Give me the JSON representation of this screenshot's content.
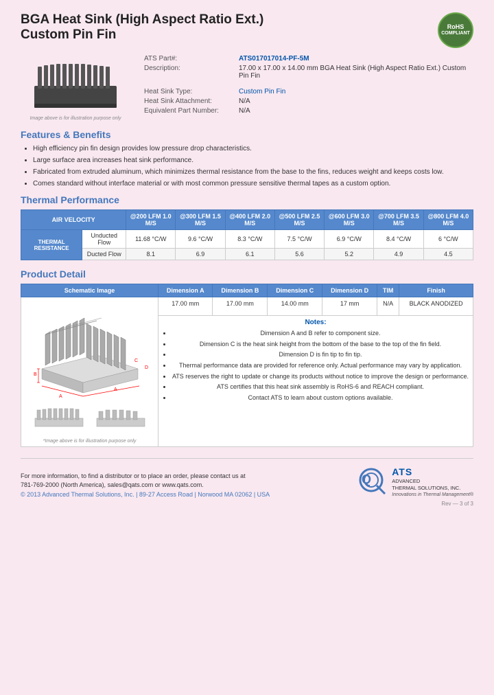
{
  "header": {
    "title_line1": "BGA Heat Sink (High Aspect Ratio Ext.)",
    "title_line2": "Custom Pin Fin",
    "rohs_main": "RoHS",
    "rohs_sub": "COMPLIANT"
  },
  "product_image": {
    "note": "Image above is for illustration purpose only"
  },
  "details": {
    "part_number_label": "ATS Part#:",
    "part_number": "ATS017017014-PF-5M",
    "description_label": "Description:",
    "description": "17.00 x 17.00 x 14.00 mm BGA Heat Sink (High Aspect Ratio Ext.) Custom Pin Fin",
    "heat_sink_type_label": "Heat Sink Type:",
    "heat_sink_type": "Custom Pin Fin",
    "attachment_label": "Heat Sink Attachment:",
    "attachment": "N/A",
    "equivalent_part_label": "Equivalent Part Number:",
    "equivalent_part": "N/A"
  },
  "features": {
    "title": "Features & Benefits",
    "items": [
      "High efficiency pin fin design provides low pressure drop characteristics.",
      "Large surface area increases heat sink performance.",
      "Fabricated from extruded aluminum, which minimizes thermal resistance from the base to the fins, reduces weight and keeps costs low.",
      "Comes standard without interface material or with most common pressure sensitive thermal tapes as a custom option."
    ]
  },
  "thermal": {
    "title": "Thermal Performance",
    "header_col1": "AIR VELOCITY",
    "columns": [
      "@200 LFM\n1.0 M/S",
      "@300 LFM\n1.5 M/S",
      "@400 LFM\n2.0 M/S",
      "@500 LFM\n2.5 M/S",
      "@600 LFM\n3.0 M/S",
      "@700 LFM\n3.5 M/S",
      "@800 LFM\n4.0 M/S"
    ],
    "row_label": "THERMAL RESISTANCE",
    "row1_label": "Unducted Flow",
    "row1": [
      "11.68 °C/W",
      "9.6 °C/W",
      "8.3 °C/W",
      "7.5 °C/W",
      "6.9 °C/W",
      "8.4 °C/W",
      "6 °C/W"
    ],
    "row2_label": "Ducted Flow",
    "row2": [
      "8.1",
      "6.9",
      "6.1",
      "5.6",
      "5.2",
      "4.9",
      "4.5"
    ]
  },
  "product_detail": {
    "title": "Product Detail",
    "headers": [
      "Schematic Image",
      "Dimension A",
      "Dimension B",
      "Dimension C",
      "Dimension D",
      "TIM",
      "Finish"
    ],
    "values": {
      "dim_a": "17.00 mm",
      "dim_b": "17.00 mm",
      "dim_c": "14.00 mm",
      "dim_d": "17 mm",
      "tim": "N/A",
      "finish": "BLACK ANODIZED"
    },
    "image_note": "*Image above is for illustration purpose only",
    "notes_title": "Notes:",
    "notes": [
      "Dimension A and B refer to component size.",
      "Dimension C is the heat sink height from the bottom of the base to the top of the fin field.",
      "Dimension D is fin tip to fin tip.",
      "Thermal performance data are provided for reference only. Actual performance may vary by application.",
      "ATS reserves the right to update or change its products without notice to improve the design or performance.",
      "ATS certifies that this heat sink assembly is RoHS-6 and REACH compliant.",
      "Contact ATS to learn about custom options available."
    ]
  },
  "footer": {
    "contact_text": "For more information, to find a distributor or to place an order, please contact us at",
    "phone_line": "781-769-2000 (North America), sales@qats.com or www.qats.com.",
    "copyright": "© 2013 Advanced Thermal Solutions, Inc.  |  89-27 Access Road  |  Norwood MA  02062  |  USA",
    "ats_name": "ATS",
    "ats_sub1": "ADVANCED",
    "ats_sub2": "THERMAL SOLUTIONS, INC.",
    "ats_tagline": "Innovations in Thermal Management®",
    "page_num": "Rev — 3 of 3"
  }
}
